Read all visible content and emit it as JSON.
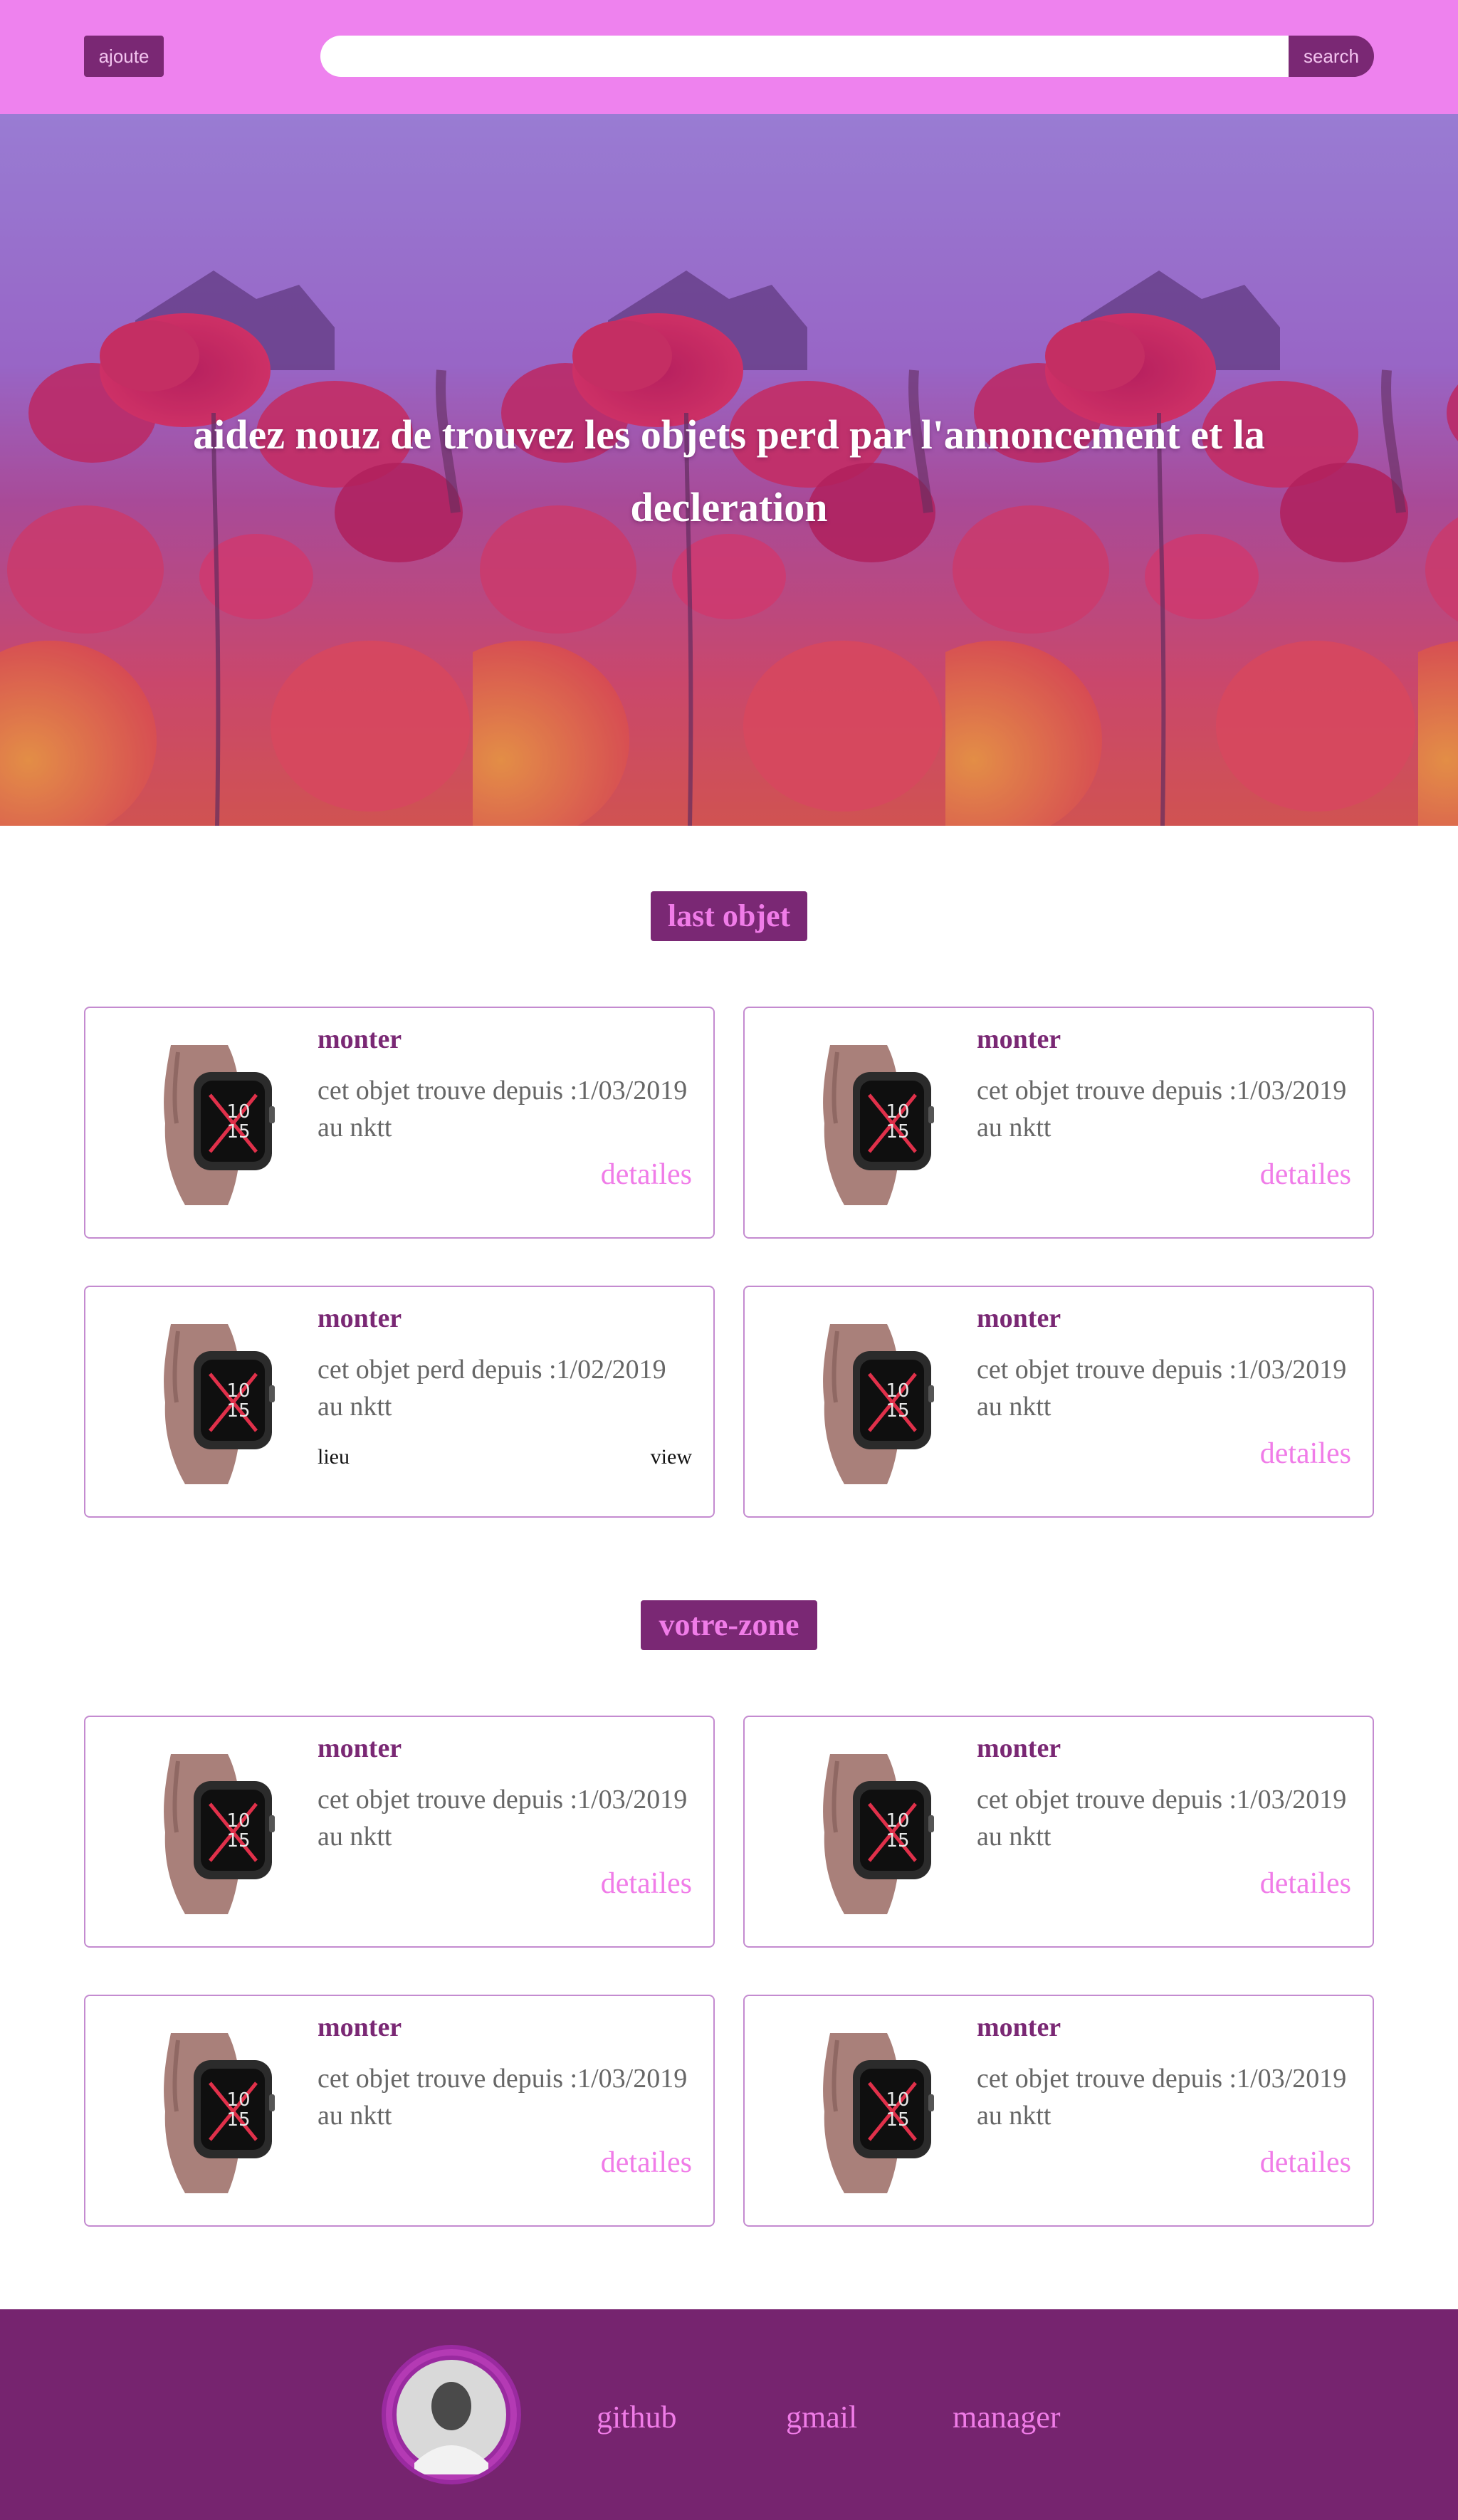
{
  "header": {
    "add_label": "ajoute",
    "search_placeholder": "",
    "search_label": "search"
  },
  "hero": {
    "title": "aidez nouz de trouvez les objets perd par l'annoncement et la decleration"
  },
  "sections": {
    "last": {
      "title": "last objet",
      "cards": [
        {
          "title": "monter",
          "desc": "cet objet trouve depuis :1/03/2019 au nktt",
          "link": "detailes"
        },
        {
          "title": "monter",
          "desc": "cet objet trouve depuis :1/03/2019 au nktt",
          "link": "detailes"
        },
        {
          "title": "monter",
          "desc": "cet objet perd depuis :1/02/2019 au nktt",
          "lieu": "lieu",
          "view": "view"
        },
        {
          "title": "monter",
          "desc": "cet objet trouve depuis :1/03/2019 au nktt",
          "link": "detailes"
        }
      ]
    },
    "zone": {
      "title": "votre-zone",
      "cards": [
        {
          "title": "monter",
          "desc": "cet objet trouve depuis :1/03/2019 au nktt",
          "link": "detailes"
        },
        {
          "title": "monter",
          "desc": "cet objet trouve depuis :1/03/2019 au nktt",
          "link": "detailes"
        },
        {
          "title": "monter",
          "desc": "cet objet trouve depuis :1/03/2019 au nktt",
          "link": "detailes"
        },
        {
          "title": "monter",
          "desc": "cet objet trouve depuis :1/03/2019 au nktt",
          "link": "detailes"
        }
      ]
    }
  },
  "footer": {
    "links": [
      "github",
      "gmail",
      "manager"
    ]
  },
  "colors": {
    "header_bg": "#ee82ee",
    "accent_dark": "#7a2874",
    "accent_pink": "#f07ce8",
    "footer_bg": "#76246f"
  }
}
